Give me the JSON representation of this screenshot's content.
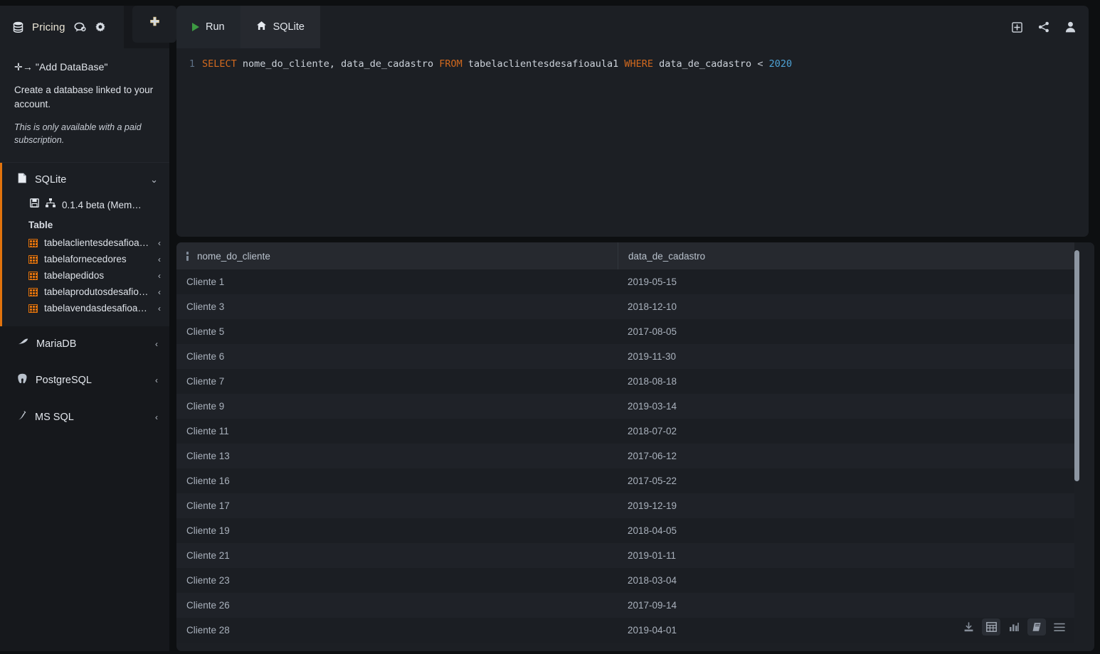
{
  "header": {
    "pricing_label": "Pricing",
    "chat_icon": "chat-icon",
    "settings_icon": "gear-icon",
    "add_icon": "plus-icon"
  },
  "sidebar": {
    "info": {
      "title": "✛→ \"Add DataBase\"",
      "body": "Create a database linked to your account.",
      "note": "This is only available with a paid subscription."
    },
    "sqlite": {
      "name": "SQLite",
      "chevron": "⌄",
      "connection": "0.1.4 beta (Mem…",
      "section_label": "Table",
      "tables": [
        {
          "name": "tabelaclientesdesafioau…",
          "chevron": "‹"
        },
        {
          "name": "tabelafornecedores",
          "chevron": "‹"
        },
        {
          "name": "tabelapedidos",
          "chevron": "‹"
        },
        {
          "name": "tabelaprodutosdesafioa…",
          "chevron": "‹"
        },
        {
          "name": "tabelavendasdesafioaul…",
          "chevron": "‹"
        }
      ]
    },
    "engines": [
      {
        "name": "MariaDB",
        "chevron": "‹"
      },
      {
        "name": "PostgreSQL",
        "chevron": "‹"
      },
      {
        "name": "MS SQL",
        "chevron": "‹"
      }
    ]
  },
  "tabs": {
    "run_label": "Run",
    "sqlite_label": "SQLite",
    "right_icons": [
      "add-tab-icon",
      "share-icon",
      "account-icon"
    ]
  },
  "editor": {
    "line_number": "1",
    "tokens": [
      {
        "t": "SELECT",
        "k": "kw"
      },
      {
        "t": " nome_do_cliente, data_de_cadastro ",
        "k": "id"
      },
      {
        "t": "FROM",
        "k": "kw"
      },
      {
        "t": " tabelaclientesdesafioaula1 ",
        "k": "id"
      },
      {
        "t": "WHERE",
        "k": "kw"
      },
      {
        "t": " data_de_cadastro ",
        "k": "id"
      },
      {
        "t": "< ",
        "k": "op"
      },
      {
        "t": "2020",
        "k": "num"
      }
    ]
  },
  "results": {
    "columns": [
      "nome_do_cliente",
      "data_de_cadastro"
    ],
    "rows": [
      [
        "Cliente 1",
        "2019-05-15"
      ],
      [
        "Cliente 3",
        "2018-12-10"
      ],
      [
        "Cliente 5",
        "2017-08-05"
      ],
      [
        "Cliente 6",
        "2019-11-30"
      ],
      [
        "Cliente 7",
        "2018-08-18"
      ],
      [
        "Cliente 9",
        "2019-03-14"
      ],
      [
        "Cliente 11",
        "2018-07-02"
      ],
      [
        "Cliente 13",
        "2017-06-12"
      ],
      [
        "Cliente 16",
        "2017-05-22"
      ],
      [
        "Cliente 17",
        "2019-12-19"
      ],
      [
        "Cliente 19",
        "2018-04-05"
      ],
      [
        "Cliente 21",
        "2019-01-11"
      ],
      [
        "Cliente 23",
        "2018-03-04"
      ],
      [
        "Cliente 26",
        "2017-09-14"
      ],
      [
        "Cliente 28",
        "2019-04-01"
      ]
    ],
    "toolbar_icons": [
      "download-icon",
      "table-view-icon",
      "chart-view-icon",
      "notebook-icon",
      "menu-icon"
    ]
  },
  "colors": {
    "accent_orange": "#e2730d",
    "run_green": "#3d9a42",
    "panel_bg": "#1c1f24",
    "app_bg": "#16181c"
  }
}
